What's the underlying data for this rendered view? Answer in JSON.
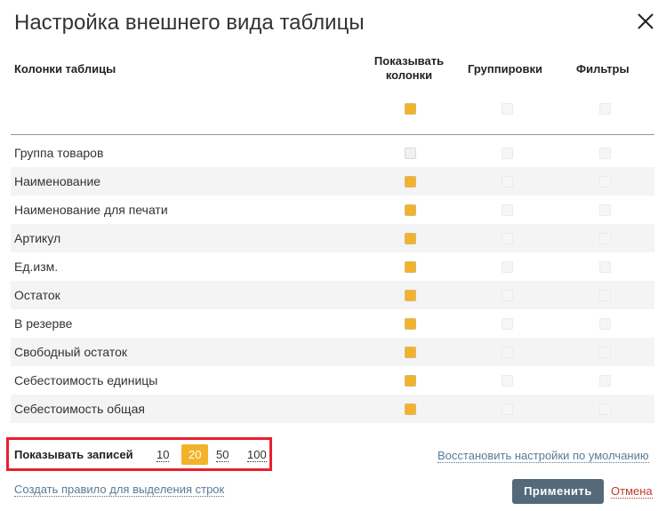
{
  "dialog": {
    "title": "Настройка внешнего вида таблицы",
    "close_icon": "close-icon"
  },
  "headers": {
    "columns": "Колонки таблицы",
    "show_line1": "Показывать",
    "show_line2": "колонки",
    "groupings": "Группировки",
    "filters": "Фильтры"
  },
  "select_all": {
    "show": true,
    "group": false,
    "filter": false
  },
  "rows": [
    {
      "label": "Группа товаров",
      "show": false,
      "group": false,
      "filter": false
    },
    {
      "label": "Наименование",
      "show": true,
      "group": false,
      "filter": false
    },
    {
      "label": "Наименование для печати",
      "show": true,
      "group": false,
      "filter": false
    },
    {
      "label": "Артикул",
      "show": true,
      "group": false,
      "filter": false
    },
    {
      "label": "Ед.изм.",
      "show": true,
      "group": false,
      "filter": false
    },
    {
      "label": "Остаток",
      "show": true,
      "group": false,
      "filter": false
    },
    {
      "label": "В резерве",
      "show": true,
      "group": false,
      "filter": false
    },
    {
      "label": "Свободный остаток",
      "show": true,
      "group": false,
      "filter": false
    },
    {
      "label": "Себестоимость единицы",
      "show": true,
      "group": false,
      "filter": false
    },
    {
      "label": "Себестоимость общая",
      "show": true,
      "group": false,
      "filter": false
    }
  ],
  "footer": {
    "show_records_label": "Показывать записей",
    "page_sizes": [
      "10",
      "20",
      "50",
      "100"
    ],
    "selected_page_size": "20",
    "restore_defaults": "Восстановить настройки по умолчанию",
    "create_rule": "Создать правило для выделения строк",
    "apply": "Применить",
    "cancel": "Отмена"
  },
  "colors": {
    "accent": "#f2b32b",
    "apply_button": "#546a7a",
    "highlight_border": "#e8202e",
    "cancel": "#c0392b"
  }
}
